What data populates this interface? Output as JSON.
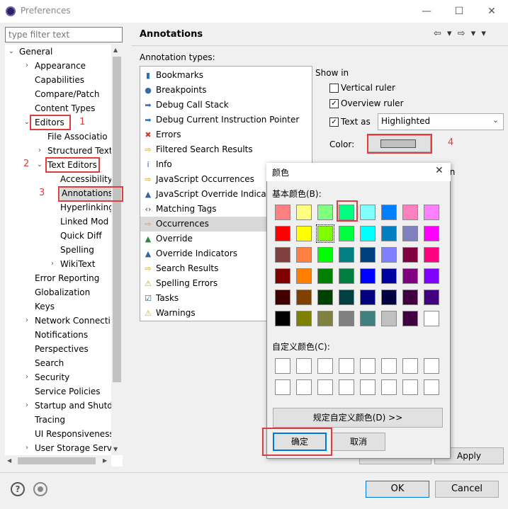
{
  "window": {
    "title": "Preferences",
    "minimize_glyph": "—",
    "maximize_glyph": "☐",
    "close_glyph": "✕"
  },
  "filter": {
    "placeholder": "type filter text"
  },
  "tree": {
    "items": [
      {
        "label": "General",
        "arrow": "⌄"
      },
      {
        "label": "Appearance",
        "arrow": "›"
      },
      {
        "label": "Capabilities"
      },
      {
        "label": "Compare/Patch"
      },
      {
        "label": "Content Types"
      },
      {
        "label": "Editors",
        "arrow": "⌄"
      },
      {
        "label": "File Associatio"
      },
      {
        "label": "Structured Text",
        "arrow": "›"
      },
      {
        "label": "Text Editors",
        "arrow": "⌄"
      },
      {
        "label": "Accessibility"
      },
      {
        "label": "Annotations"
      },
      {
        "label": "Hyperlinking"
      },
      {
        "label": "Linked Mod"
      },
      {
        "label": "Quick Diff"
      },
      {
        "label": "Spelling"
      },
      {
        "label": "WikiText",
        "arrow": "›"
      },
      {
        "label": "Error Reporting"
      },
      {
        "label": "Globalization"
      },
      {
        "label": "Keys"
      },
      {
        "label": "Network Connecti",
        "arrow": "›"
      },
      {
        "label": "Notifications"
      },
      {
        "label": "Perspectives"
      },
      {
        "label": "Search"
      },
      {
        "label": "Security",
        "arrow": "›"
      },
      {
        "label": "Service Policies"
      },
      {
        "label": "Startup and Shutd",
        "arrow": "›"
      },
      {
        "label": "Tracing"
      },
      {
        "label": "UI Responsiveness"
      },
      {
        "label": "User Storage Serv",
        "arrow": "›"
      }
    ],
    "scroll_up": "▲",
    "scroll_down": "▼",
    "scroll_left": "◀",
    "scroll_right": "▶"
  },
  "panel": {
    "title": "Annotations",
    "nav": "⇦ ▾ ⇨ ▾ ▾",
    "types_label": "Annotation types:",
    "types": [
      {
        "label": "Bookmarks",
        "icon": "bookmark-icon",
        "glyph": "▮",
        "color": "#2c6fb6"
      },
      {
        "label": "Breakpoints",
        "icon": "breakpoint-icon",
        "glyph": "●",
        "color": "#3a6aa8"
      },
      {
        "label": "Debug Call Stack",
        "icon": "call-stack-icon",
        "glyph": "➡",
        "color": "#2e6fbf"
      },
      {
        "label": "Debug Current Instruction Pointer",
        "icon": "instruction-pointer-icon",
        "glyph": "➡",
        "color": "#2e6fbf"
      },
      {
        "label": "Errors",
        "icon": "error-icon",
        "glyph": "✖",
        "color": "#d9362b"
      },
      {
        "label": "Filtered Search Results",
        "icon": "search-result-icon",
        "glyph": "⇨",
        "color": "#d8a21a"
      },
      {
        "label": "Info",
        "icon": "info-icon",
        "glyph": "i",
        "color": "#2d5fa0"
      },
      {
        "label": "JavaScript Occurrences",
        "icon": "js-occurrence-icon",
        "glyph": "⇨",
        "color": "#d8a21a"
      },
      {
        "label": "JavaScript Override Indicat",
        "icon": "js-override-icon",
        "glyph": "▲",
        "color": "#336699"
      },
      {
        "label": "Matching Tags",
        "icon": "matching-tags-icon",
        "glyph": "‹›",
        "color": "#333333"
      },
      {
        "label": "Occurrences",
        "icon": "occurrence-icon",
        "glyph": "⇨",
        "color": "#d8a21a"
      },
      {
        "label": "Override",
        "icon": "override-icon",
        "glyph": "▲",
        "color": "#2a8a3a"
      },
      {
        "label": "Override Indicators",
        "icon": "override-indicator-icon",
        "glyph": "▲",
        "color": "#336699"
      },
      {
        "label": "Search Results",
        "icon": "search-results-icon",
        "glyph": "⇨",
        "color": "#d8a21a"
      },
      {
        "label": "Spelling Errors",
        "icon": "spelling-icon",
        "glyph": "⚠",
        "color": "#d8a21a"
      },
      {
        "label": "Tasks",
        "icon": "task-icon",
        "glyph": "☑",
        "color": "#336699"
      },
      {
        "label": "Warnings",
        "icon": "warning-icon",
        "glyph": "⚠",
        "color": "#e0a800"
      }
    ],
    "show_in_label": "Show in",
    "vertical_ruler": {
      "label": "Vertical ruler",
      "checked": false
    },
    "overview_ruler": {
      "label": "Overview ruler",
      "checked": true
    },
    "text_as": {
      "label": "Text as",
      "checked": true,
      "value": "Highlighted"
    },
    "color_label": "Color:",
    "ation_text": "ation",
    "apply": "Apply"
  },
  "bottom": {
    "help": "?",
    "ok": "OK",
    "cancel": "Cancel"
  },
  "color_dialog": {
    "title": "颜色",
    "close_glyph": "✕",
    "basic_label": "基本颜色(B):",
    "basic_colors": [
      "#ff8080",
      "#ffff80",
      "#80ff80",
      "#00ff80",
      "#80ffff",
      "#0080ff",
      "#ff80c0",
      "#ff80ff",
      "#ff0000",
      "#ffff00",
      "#80ff00",
      "#00ff40",
      "#00ffff",
      "#0080c0",
      "#8080c0",
      "#ff00ff",
      "#804040",
      "#ff8040",
      "#00ff00",
      "#008080",
      "#004080",
      "#8080ff",
      "#800040",
      "#ff0080",
      "#800000",
      "#ff8000",
      "#008000",
      "#008040",
      "#0000ff",
      "#0000a0",
      "#800080",
      "#8000ff",
      "#400000",
      "#804000",
      "#004000",
      "#004040",
      "#000080",
      "#000040",
      "#400040",
      "#400080",
      "#000000",
      "#808000",
      "#808040",
      "#808080",
      "#408080",
      "#c0c0c0",
      "#400040",
      "#ffffff"
    ],
    "custom_label": "自定义颜色(C):",
    "define_button": "规定自定义颜色(D) >>",
    "ok": "确定",
    "cancel": "取消"
  },
  "annotations": {
    "n1": "1",
    "n2": "2",
    "n3": "3",
    "n4": "4"
  }
}
